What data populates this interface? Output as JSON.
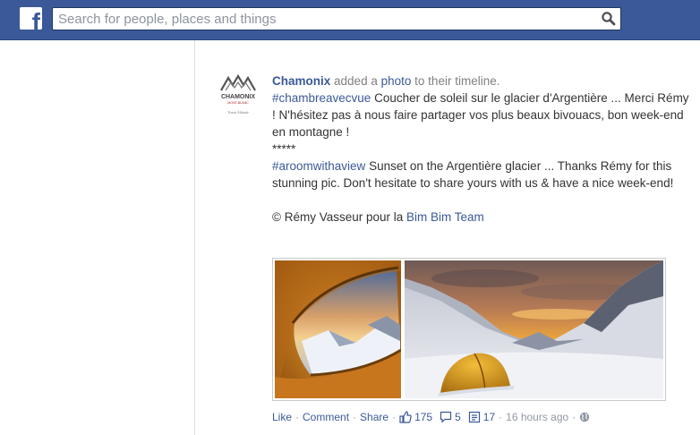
{
  "header": {
    "logo_glyph": "f",
    "search_placeholder": "Search for people, places and things"
  },
  "post": {
    "page_name": "Chamonix",
    "action_middle": "added a",
    "action_link": "photo",
    "action_end": "to their timeline.",
    "avatar": {
      "brand": "CHAMONIX",
      "sub": "MONT-BLANC",
      "tagline": "Travis Altitude"
    },
    "fr_hashtag": "#chambreavecvue",
    "fr_text": "Coucher de soleil sur le glacier d'Argentière ... Merci Rémy ! N'hésitez pas à nous faire partager vos plus beaux bivouacs, bon week-end en montagne !",
    "stars": "*****",
    "en_hashtag": "#aroomwithaview",
    "en_text": "Sunset on the Argentière glacier ... Thanks Rémy for this stunning pic. Don't hesitate to share yours with us & have a nice week-end!",
    "credit_text": "© Rémy Vasseur pour la",
    "credit_link": "Bim Bim Team"
  },
  "actions": {
    "like": "Like",
    "comment": "Comment",
    "share": "Share",
    "likes_count": "175",
    "comments_count": "5",
    "shares_count": "17",
    "timestamp": "16 hours ago"
  },
  "colors": {
    "brand_blue": "#3b5998",
    "text": "#333333",
    "muted": "#9197a3"
  }
}
